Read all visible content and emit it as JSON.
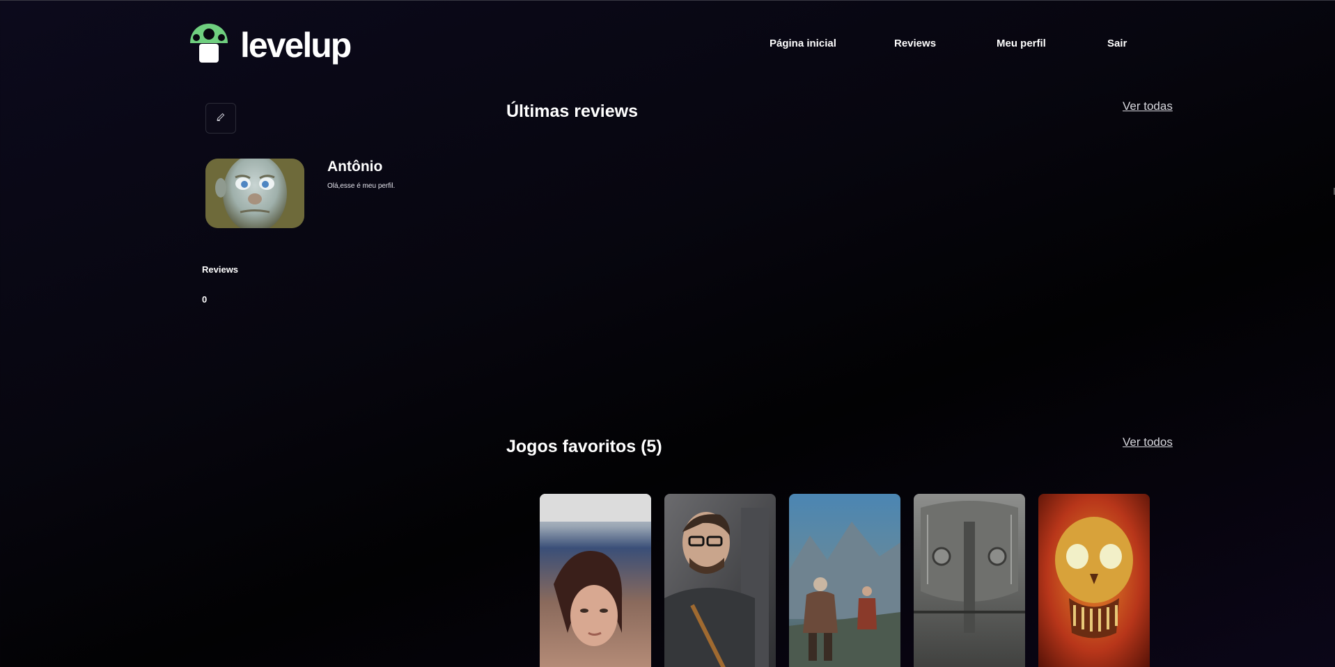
{
  "header": {
    "logo_text": "levelup",
    "logo_icon": "mushroom-icon",
    "nav": [
      {
        "label": "Página inicial"
      },
      {
        "label": "Reviews"
      },
      {
        "label": "Meu perfil"
      },
      {
        "label": "Sair"
      }
    ]
  },
  "profile": {
    "edit_icon": "pencil-icon",
    "name": "Antônio",
    "bio": "Olá,esse é meu perfil.",
    "stats": {
      "label": "Reviews",
      "value": "0"
    }
  },
  "latest_reviews": {
    "title": "Últimas reviews",
    "see_all": "Ver todas"
  },
  "favorites": {
    "title": "Jogos favoritos (5)",
    "see_all": "Ver todos",
    "games": [
      {
        "cover": "girl-short-hair-cover"
      },
      {
        "cover": "scientist-glasses-cover"
      },
      {
        "cover": "warrior-mountains-cover"
      },
      {
        "cover": "metal-armor-cover"
      },
      {
        "cover": "flaming-skull-cover"
      }
    ]
  },
  "colors": {
    "accent": "#6fcf7f",
    "background": "#05040c",
    "text": "#ffffff"
  }
}
